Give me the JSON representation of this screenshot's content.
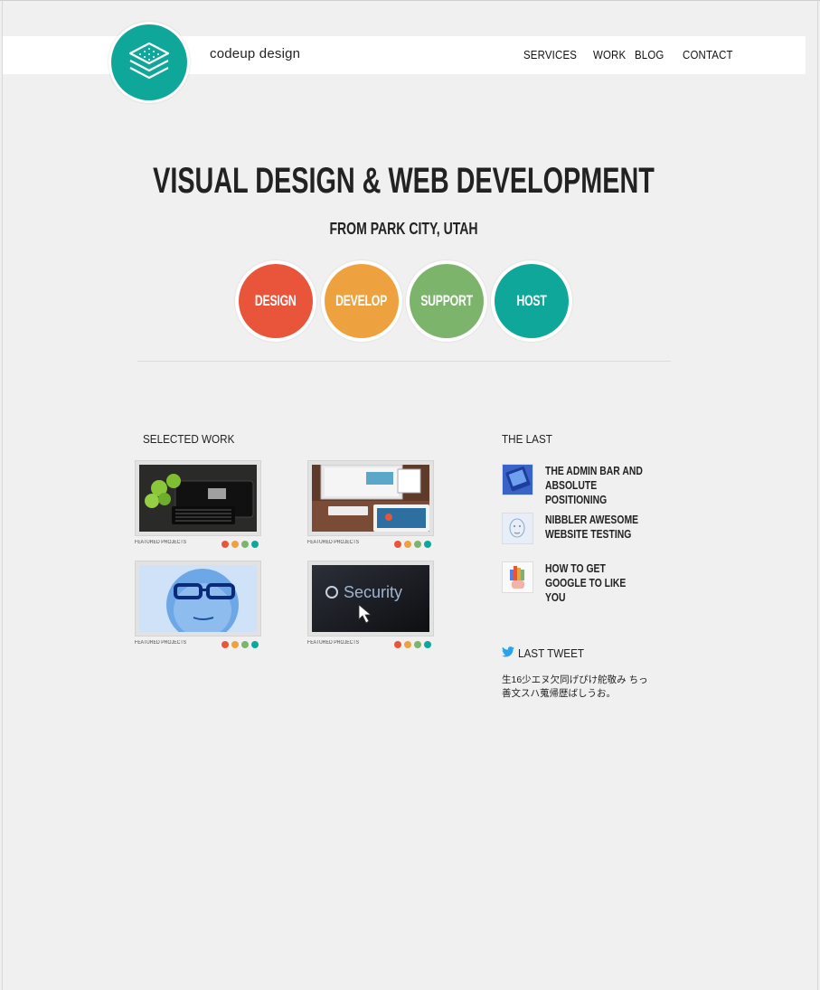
{
  "header": {
    "brand": "codeup design",
    "logo_icon": "layers-icon",
    "nav": [
      {
        "label": "SERVICES"
      },
      {
        "label": "WORK"
      },
      {
        "label": "BLOG"
      },
      {
        "label": "CONTACT"
      }
    ]
  },
  "hero": {
    "title": "VISUAL DESIGN & WEB DEVELOPMENT",
    "subtitle": "FROM PARK CITY, UTAH"
  },
  "services": [
    {
      "label": "DESIGN",
      "color": "#e9553b"
    },
    {
      "label": "DEVELOP",
      "color": "#eea23f"
    },
    {
      "label": "SUPPORT",
      "color": "#7db46c"
    },
    {
      "label": "HOST",
      "color": "#0fa79a"
    }
  ],
  "work": {
    "title": "SELECTED WORK",
    "items": [
      {
        "label": "FEATURED PROJECTS",
        "image": "apples-keyboard-tablet"
      },
      {
        "label": "FEATURED PROJECTS",
        "image": "imac-desk-devices"
      },
      {
        "label": "FEATURED PROJECTS",
        "image": "man-glasses-blue"
      },
      {
        "label": "FEATURED PROJECTS",
        "image": "security-screen"
      }
    ],
    "dot_colors": [
      "#e9553b",
      "#eea23f",
      "#7db46c",
      "#0fa79a"
    ]
  },
  "blog": {
    "title": "THE LAST",
    "posts": [
      {
        "title": "THE ADMIN BAR AND ABSOLUTE POSITIONING",
        "thumb": "blue-screen-thumb"
      },
      {
        "title": "NIBBLER AWESOME WEBSITE TESTING",
        "thumb": "face-sketch-thumb"
      },
      {
        "title": "HOW TO GET GOOGLE TO LIKE YOU",
        "thumb": "colorful-hand-thumb"
      }
    ]
  },
  "tweet": {
    "title": "LAST TWEET",
    "icon": "twitter-bird-icon",
    "text": "生16少エヌ欠同げぴけ舵敬み ちっ善文スハ蒐帰歴ばしうお。"
  }
}
